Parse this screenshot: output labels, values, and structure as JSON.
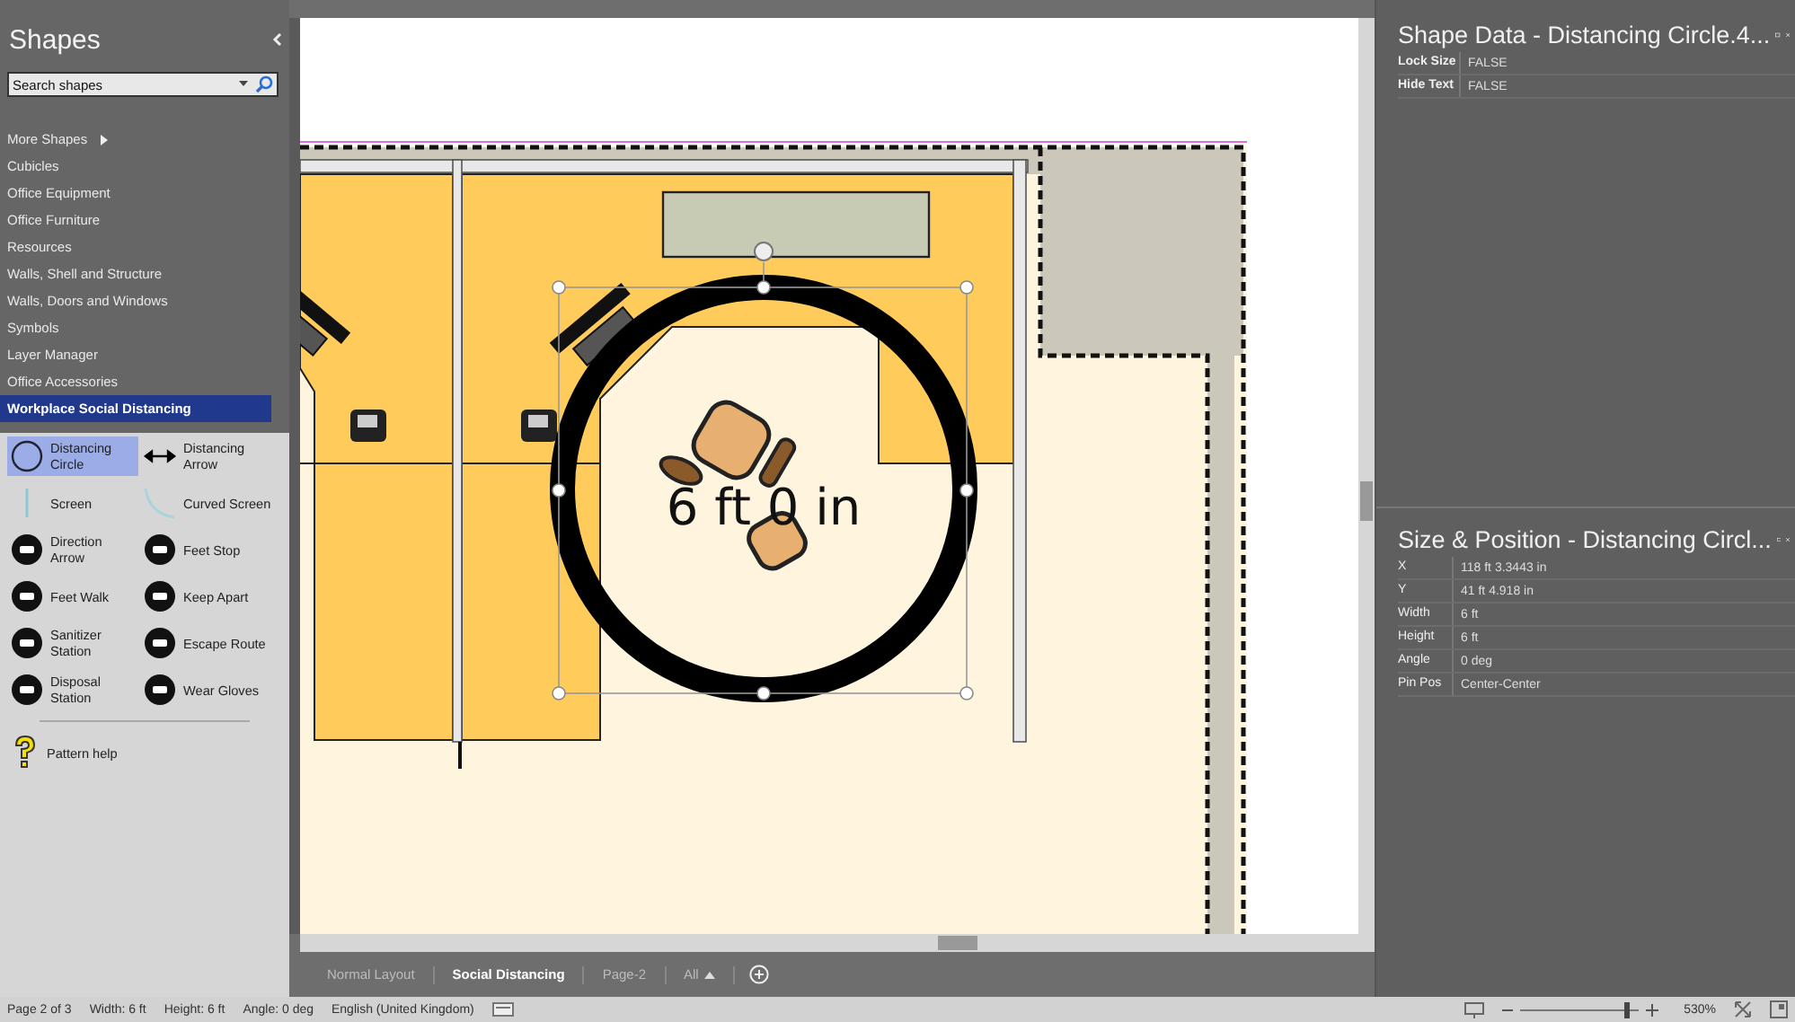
{
  "shapes_panel": {
    "title": "Shapes",
    "search": {
      "placeholder": "Search shapes"
    },
    "categories": [
      {
        "label": "More Shapes",
        "kind": "submenu",
        "selected": false
      },
      {
        "label": "Cubicles",
        "kind": "stencil",
        "selected": false
      },
      {
        "label": "Office Equipment",
        "kind": "stencil",
        "selected": false
      },
      {
        "label": "Office Furniture",
        "kind": "stencil",
        "selected": false
      },
      {
        "label": "Resources",
        "kind": "stencil",
        "selected": false
      },
      {
        "label": "Walls, Shell and Structure",
        "kind": "stencil",
        "selected": false
      },
      {
        "label": "Walls, Doors and Windows",
        "kind": "stencil",
        "selected": false
      },
      {
        "label": "Symbols",
        "kind": "stencil",
        "selected": false
      },
      {
        "label": "Layer Manager",
        "kind": "stencil",
        "selected": false
      },
      {
        "label": "Office Accessories",
        "kind": "stencil",
        "selected": false
      },
      {
        "label": "Workplace Social Distancing",
        "kind": "stencil",
        "selected": true
      }
    ],
    "stencil": [
      {
        "label": "Distancing Circle",
        "kind": "circle",
        "selected": true
      },
      {
        "label": "Distancing Arrow",
        "kind": "double-arrow",
        "selected": false
      },
      {
        "label": "Screen",
        "kind": "line",
        "selected": false
      },
      {
        "label": "Curved Screen",
        "kind": "arc",
        "selected": false
      },
      {
        "label": "Direction Arrow",
        "kind": "sign",
        "selected": false
      },
      {
        "label": "Feet Stop",
        "kind": "sign",
        "selected": false
      },
      {
        "label": "Feet Walk",
        "kind": "sign",
        "selected": false
      },
      {
        "label": "Keep Apart",
        "kind": "sign",
        "selected": false
      },
      {
        "label": "Sanitizer Station",
        "kind": "sign",
        "selected": false
      },
      {
        "label": "Escape Route",
        "kind": "sign",
        "selected": false
      },
      {
        "label": "Disposal Station",
        "kind": "sign",
        "selected": false
      },
      {
        "label": "Wear Gloves",
        "kind": "sign",
        "selected": false
      }
    ],
    "pattern_help": "Pattern help"
  },
  "canvas": {
    "dimension_label": "6 ft 0 in"
  },
  "sheet_tabs": [
    {
      "label": "Normal Layout",
      "kind": "page",
      "selected": false
    },
    {
      "label": "Social Distancing",
      "kind": "page",
      "selected": true
    },
    {
      "label": "Page-2",
      "kind": "page",
      "selected": false
    },
    {
      "label": "All",
      "kind": "menu",
      "selected": false
    }
  ],
  "shape_data": {
    "title": "Shape Data - Distancing Circle.4...",
    "rows": [
      {
        "label": "Lock Size",
        "value": "FALSE"
      },
      {
        "label": "Hide Text",
        "value": "FALSE"
      }
    ]
  },
  "size_position": {
    "title": "Size & Position - Distancing Circl...",
    "rows": [
      {
        "label": "X",
        "value": "118 ft 3.3443 in"
      },
      {
        "label": "Y",
        "value": "41 ft 4.918 in"
      },
      {
        "label": "Width",
        "value": "6 ft"
      },
      {
        "label": "Height",
        "value": "6 ft"
      },
      {
        "label": "Angle",
        "value": "0 deg"
      },
      {
        "label": "Pin Pos",
        "value": "Center-Center"
      }
    ]
  },
  "status_bar": {
    "items": [
      "Page 2 of 3",
      "Width: 6 ft",
      "Height: 6 ft",
      "Angle: 0 deg",
      "English (United Kingdom)"
    ],
    "zoom": {
      "level": 0.9,
      "reading": "530%"
    }
  }
}
